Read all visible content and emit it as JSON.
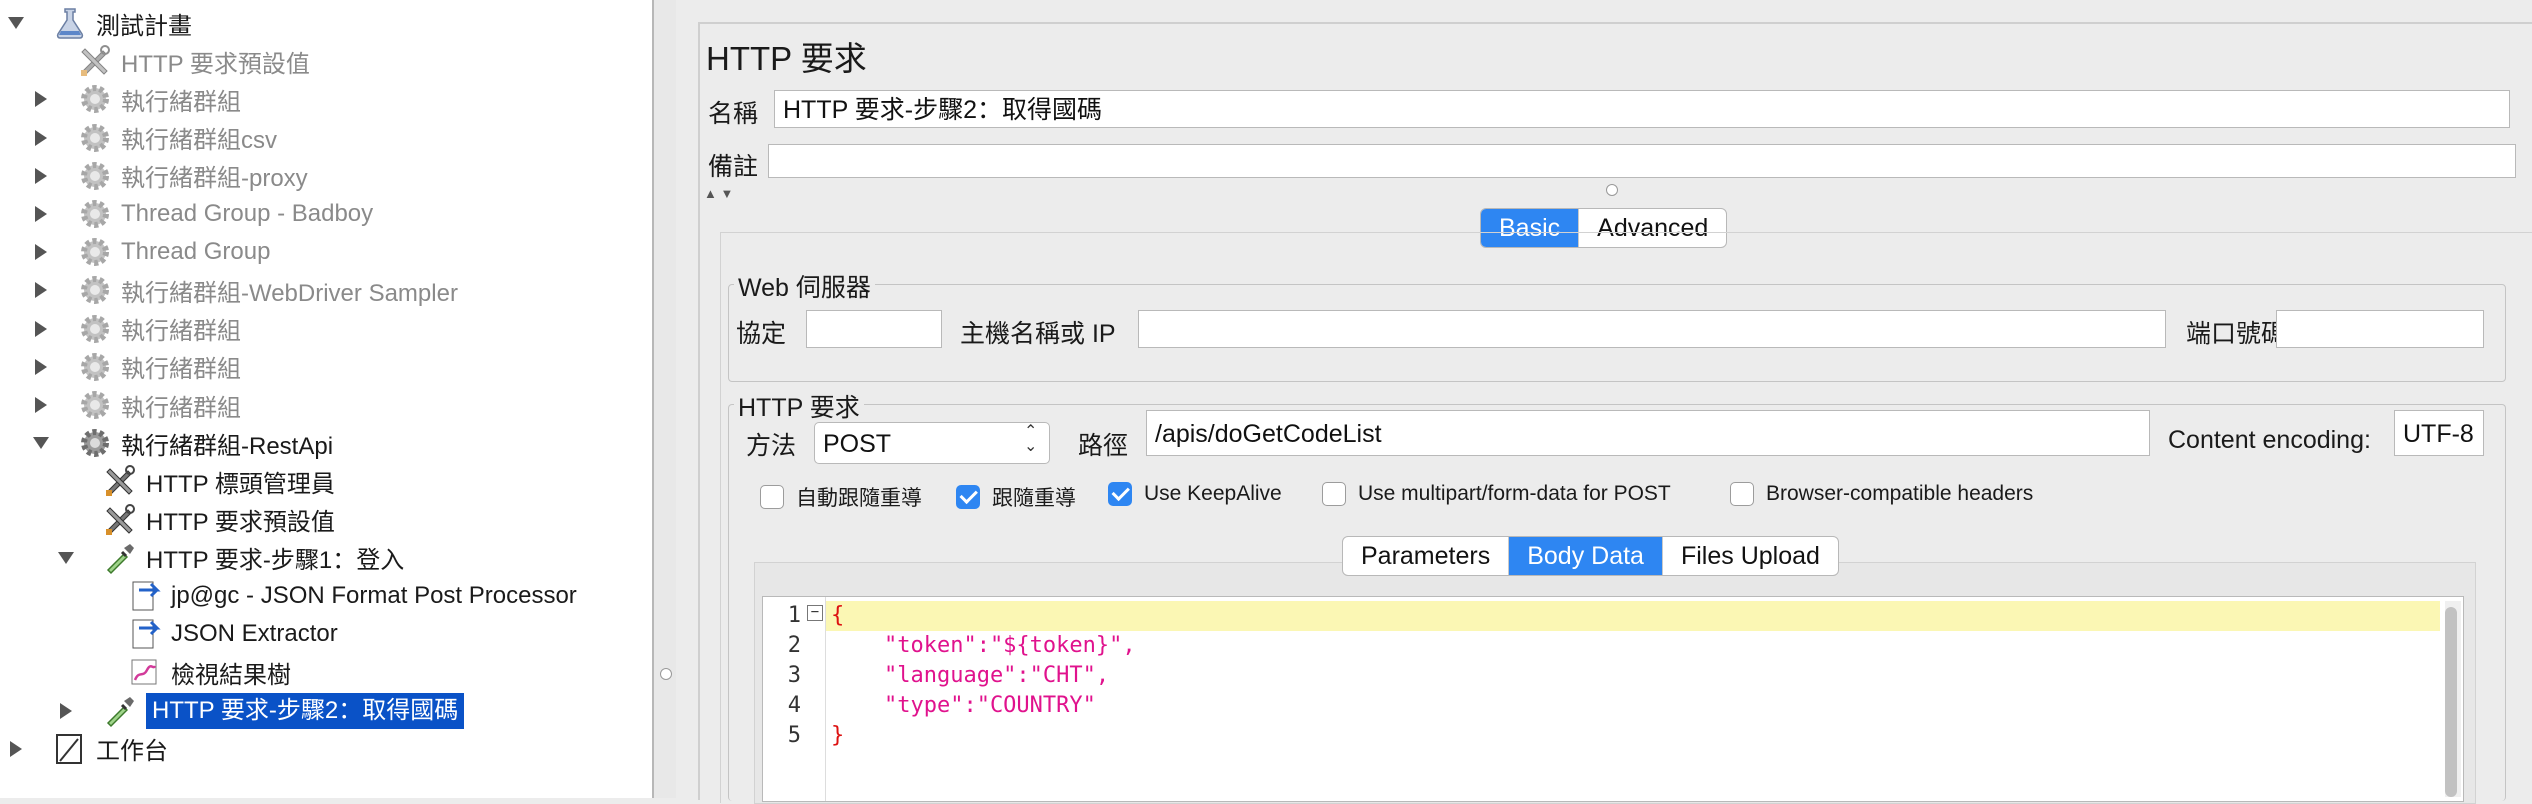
{
  "tree": {
    "items": [
      {
        "label": "測試計畫",
        "icon": "test-plan-flask-icon",
        "state": "expanded",
        "disabled": false
      },
      {
        "label": "HTTP 要求預設值",
        "icon": "wrench-tools-icon",
        "state": "leaf",
        "disabled": true
      },
      {
        "label": "執行緒群組",
        "icon": "gear-icon",
        "state": "collapsed",
        "disabled": true
      },
      {
        "label": "執行緒群組csv",
        "icon": "gear-icon",
        "state": "collapsed",
        "disabled": true
      },
      {
        "label": "執行緒群組-proxy",
        "icon": "gear-icon",
        "state": "collapsed",
        "disabled": true
      },
      {
        "label": "Thread Group - Badboy",
        "icon": "gear-icon",
        "state": "collapsed",
        "disabled": true
      },
      {
        "label": "Thread Group",
        "icon": "gear-icon",
        "state": "collapsed",
        "disabled": true
      },
      {
        "label": "執行緒群組-WebDriver Sampler",
        "icon": "gear-icon",
        "state": "collapsed",
        "disabled": true
      },
      {
        "label": "執行緒群組",
        "icon": "gear-icon",
        "state": "collapsed",
        "disabled": true
      },
      {
        "label": "執行緒群組",
        "icon": "gear-icon",
        "state": "collapsed",
        "disabled": true
      },
      {
        "label": "執行緒群組",
        "icon": "gear-icon",
        "state": "collapsed",
        "disabled": true
      },
      {
        "label": "執行緒群組-RestApi",
        "icon": "gear-icon",
        "state": "expanded",
        "disabled": false
      },
      {
        "label": "HTTP 標頭管理員",
        "icon": "wrench-tools-icon",
        "state": "leaf",
        "disabled": false
      },
      {
        "label": "HTTP 要求預設值",
        "icon": "wrench-tools-icon",
        "state": "leaf",
        "disabled": false
      },
      {
        "label": "HTTP 要求-步驟1：登入",
        "icon": "pipette-sampler-icon",
        "state": "expanded",
        "disabled": false
      },
      {
        "label": "jp@gc - JSON Format Post Processor",
        "icon": "post-processor-icon",
        "state": "leaf",
        "disabled": false
      },
      {
        "label": "JSON Extractor",
        "icon": "post-processor-icon",
        "state": "leaf",
        "disabled": false
      },
      {
        "label": "檢視結果樹",
        "icon": "results-tree-icon",
        "state": "leaf",
        "disabled": false
      },
      {
        "label": "HTTP 要求-步驟2：取得國碼",
        "icon": "pipette-sampler-icon",
        "state": "collapsed",
        "disabled": false,
        "selected": true
      },
      {
        "label": "工作台",
        "icon": "workbench-icon",
        "state": "collapsed",
        "disabled": false
      }
    ]
  },
  "panel": {
    "title": "HTTP 要求",
    "name_label": "名稱",
    "name_value": "HTTP 要求-步驟2：取得國碼",
    "comment_label": "備註",
    "comment_value": "",
    "tabs": [
      "Basic",
      "Advanced"
    ],
    "active_tab": "Basic"
  },
  "web_server": {
    "title": "Web 伺服器",
    "protocol_label": "協定",
    "protocol_value": "",
    "host_label": "主機名稱或 IP",
    "host_value": "",
    "port_label": "端口號碼",
    "port_value": ""
  },
  "http_request": {
    "title": "HTTP 要求",
    "method_label": "方法",
    "method_value": "POST",
    "path_label": "路徑",
    "path_value": "/apis/doGetCodeList",
    "encoding_label": "Content encoding:",
    "encoding_value": "UTF-8",
    "checkboxes": [
      {
        "label": "自動跟隨重導",
        "checked": false
      },
      {
        "label": "跟隨重導",
        "checked": true
      },
      {
        "label": "Use KeepAlive",
        "checked": true
      },
      {
        "label": "Use multipart/form-data for POST",
        "checked": false
      },
      {
        "label": "Browser-compatible headers",
        "checked": false
      }
    ],
    "data_tabs": [
      "Parameters",
      "Body Data",
      "Files Upload"
    ],
    "active_data_tab": "Body Data"
  },
  "body_data": {
    "line_numbers": [
      "1",
      "2",
      "3",
      "4",
      "5"
    ],
    "lines": [
      "{",
      "    \"token\":\"${token}\",",
      "    \"language\":\"CHT\",",
      "    \"type\":\"COUNTRY\"",
      "}"
    ]
  }
}
